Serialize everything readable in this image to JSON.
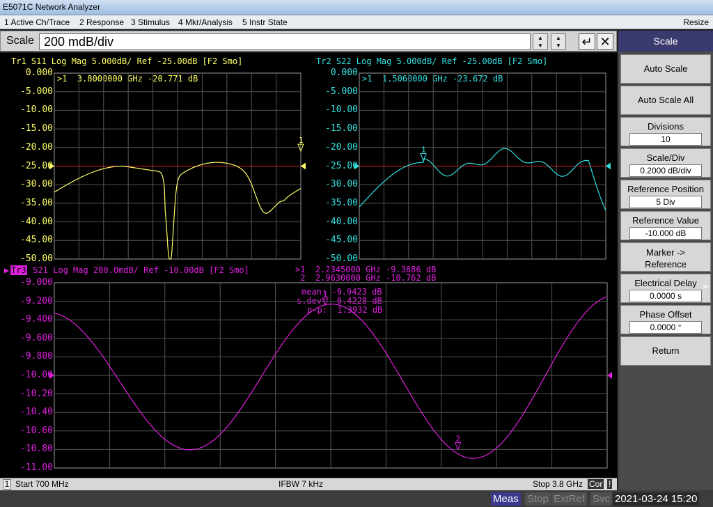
{
  "window": {
    "title": "E5071C Network Analyzer"
  },
  "menu": {
    "items": [
      "1 Active Ch/Trace",
      "2 Response",
      "3 Stimulus",
      "4 Mkr/Analysis",
      "5 Instr State"
    ],
    "resize": "Resize"
  },
  "entry": {
    "label": "Scale",
    "value": "200 mdB/div"
  },
  "softkeys": {
    "title": "Scale",
    "auto_scale": "Auto Scale",
    "auto_scale_all": "Auto Scale All",
    "divisions": {
      "label": "Divisions",
      "value": "10"
    },
    "scale_div": {
      "label": "Scale/Div",
      "value": "0.2000 dB/div"
    },
    "ref_pos": {
      "label": "Reference Position",
      "value": "5 Div"
    },
    "ref_val": {
      "label": "Reference Value",
      "value": "-10.000 dB"
    },
    "marker_ref": {
      "line1": "Marker ->",
      "line2": "Reference"
    },
    "elec_delay": {
      "label": "Electrical Delay",
      "value": "0.0000 s"
    },
    "phase_offset": {
      "label": "Phase Offset",
      "value": "0.0000 °"
    },
    "return": "Return"
  },
  "traces": {
    "tr1": {
      "title": "Tr1 S11 Log Mag 5.000dB/ Ref -25.00dB [F2 Smo]",
      "marker": ">1  3.8000000 GHz -20.771 dB",
      "yticks": [
        "0.000",
        "-5.000",
        "-10.00",
        "-15.00",
        "-20.00",
        "-25.00",
        "-30.00",
        "-35.00",
        "-40.00",
        "-45.00",
        "-50.00"
      ],
      "color": "#ffff66"
    },
    "tr2": {
      "title": "Tr2 S22 Log Mag 5.000dB/ Ref -25.00dB [F2 Smo]",
      "marker": ">1  1.5060000 GHz -23.672 dB",
      "yticks": [
        "0.000",
        "-5.000",
        "-10.00",
        "-15.00",
        "-20.00",
        "-25.00",
        "-30.00",
        "-35.00",
        "-40.00",
        "-45.00",
        "-50.00"
      ],
      "color": "#33e0e0"
    },
    "tr3": {
      "tag": "Tr3",
      "title": " S21 Log Mag 200.0mdB/ Ref -10.00dB [F2 Smo]",
      "marker1": ">1  2.2345000 GHz -9.3686 dB",
      "marker2": " 2  2.9630000 GHz -10.762 dB",
      "stats_mean": "mean: -9.9423 dB",
      "stats_sdev": "s.dev:  0.4228 dB",
      "stats_pp": "p-p:  1.3932 dB",
      "yticks": [
        "-9.000",
        "-9.200",
        "-9.400",
        "-9.600",
        "-9.800",
        "-10.00",
        "-10.20",
        "-10.40",
        "-10.60",
        "-10.80",
        "-11.00"
      ],
      "color": "#e020e0"
    }
  },
  "status": {
    "channel": "1",
    "start": "Start 700 MHz",
    "ifbw": "IFBW 7 kHz",
    "stop": "Stop 3.8 GHz",
    "cor": "Cor",
    "excl": "!"
  },
  "taskbar": {
    "meas": "Meas",
    "stop": "Stop",
    "extref": "ExtRef",
    "svc": "Svc",
    "datetime": "2021-03-24 15:20"
  }
}
